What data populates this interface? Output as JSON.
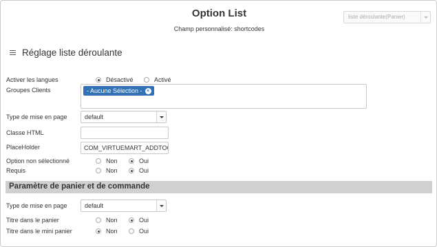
{
  "header": {
    "title": "Option List",
    "subtitle": "Champ personnalisé: shortcodes",
    "type_select": "liste déroulante(Panier)"
  },
  "section": {
    "title": "Réglage liste déroulante"
  },
  "fields": {
    "langues": {
      "label": "Activer les langues",
      "opt1": "Désactivé",
      "opt2": "Activé",
      "selected": "Désactivé"
    },
    "groupes": {
      "label": "Groupes Clients",
      "tag": "- Aucune Sélection -"
    },
    "layout1": {
      "label": "Type de mise en page",
      "value": "default"
    },
    "classe": {
      "label": "Classe HTML",
      "value": ""
    },
    "placeholder": {
      "label": "PlaceHolder",
      "value": "COM_VIRTUEMART_ADDTOC"
    },
    "option_non": {
      "label": "Option non sélectionné",
      "opt1": "Non",
      "opt2": "Oui",
      "selected": "Oui"
    },
    "requis": {
      "label": "Requis",
      "opt1": "Non",
      "opt2": "Oui",
      "selected": "Oui"
    }
  },
  "panier_section": {
    "title": "Paramètre de panier et de commande"
  },
  "panier_fields": {
    "layout2": {
      "label": "Type de mise en page",
      "value": "default"
    },
    "titre_panier": {
      "label": "Titre dans le panier",
      "opt1": "Non",
      "opt2": "Oui",
      "selected": "Oui"
    },
    "titre_mini": {
      "label": "Titre dans le mini panier",
      "opt1": "Non",
      "opt2": "Oui",
      "selected": "Non"
    }
  }
}
